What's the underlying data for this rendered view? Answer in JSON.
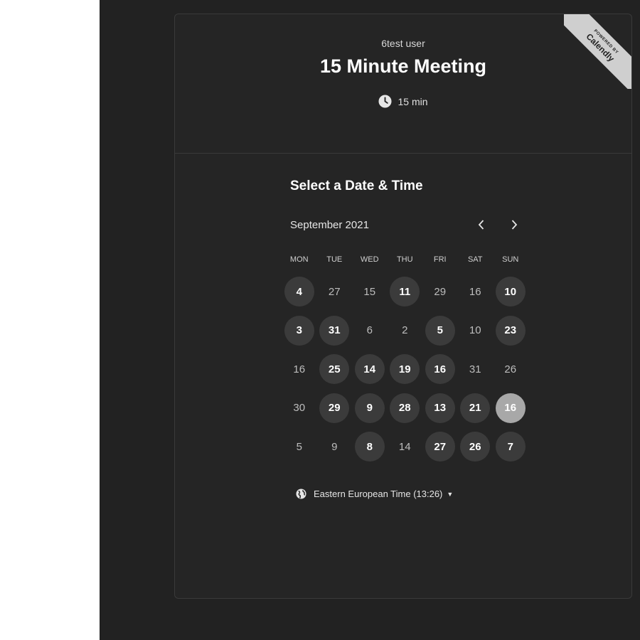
{
  "header": {
    "host_name": "6test user",
    "event_title": "15 Minute Meeting",
    "duration": "15 min"
  },
  "ribbon": {
    "small": "POWERED BY",
    "brand": "Calendly"
  },
  "calendar": {
    "section_title": "Select a Date & Time",
    "month": "September 2021",
    "weekdays": [
      "MON",
      "TUE",
      "WED",
      "THU",
      "FRI",
      "SAT",
      "SUN"
    ],
    "days": [
      {
        "label": "4",
        "state": "available"
      },
      {
        "label": "27",
        "state": "disabled"
      },
      {
        "label": "15",
        "state": "disabled"
      },
      {
        "label": "11",
        "state": "available"
      },
      {
        "label": "29",
        "state": "disabled"
      },
      {
        "label": "16",
        "state": "disabled"
      },
      {
        "label": "10",
        "state": "available"
      },
      {
        "label": "3",
        "state": "available"
      },
      {
        "label": "31",
        "state": "available"
      },
      {
        "label": "6",
        "state": "disabled"
      },
      {
        "label": "2",
        "state": "disabled"
      },
      {
        "label": "5",
        "state": "available"
      },
      {
        "label": "10",
        "state": "disabled"
      },
      {
        "label": "23",
        "state": "available"
      },
      {
        "label": "16",
        "state": "disabled"
      },
      {
        "label": "25",
        "state": "available"
      },
      {
        "label": "14",
        "state": "available"
      },
      {
        "label": "19",
        "state": "available"
      },
      {
        "label": "16",
        "state": "available"
      },
      {
        "label": "31",
        "state": "disabled"
      },
      {
        "label": "26",
        "state": "disabled"
      },
      {
        "label": "30",
        "state": "disabled"
      },
      {
        "label": "29",
        "state": "available"
      },
      {
        "label": "9",
        "state": "available"
      },
      {
        "label": "28",
        "state": "available"
      },
      {
        "label": "13",
        "state": "available"
      },
      {
        "label": "21",
        "state": "available"
      },
      {
        "label": "16",
        "state": "selected"
      },
      {
        "label": "5",
        "state": "disabled"
      },
      {
        "label": "9",
        "state": "disabled"
      },
      {
        "label": "8",
        "state": "available"
      },
      {
        "label": "14",
        "state": "disabled"
      },
      {
        "label": "27",
        "state": "available"
      },
      {
        "label": "26",
        "state": "available"
      },
      {
        "label": "7",
        "state": "available"
      }
    ]
  },
  "timezone": {
    "label": "Eastern European Time (13:26)"
  },
  "icons": {
    "duration": "clock-icon",
    "timezone": "globe-icon",
    "prev": "chevron-left-icon",
    "next": "chevron-right-icon",
    "dropdown": "caret-down-icon"
  },
  "colors": {
    "background": "#222222",
    "card": "#252525",
    "available_day": "#3b3b3b",
    "selected_day": "#a8a8a8"
  }
}
